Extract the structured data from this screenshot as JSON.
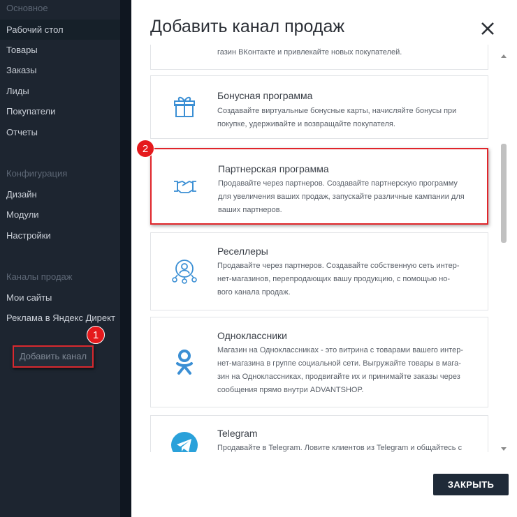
{
  "sidebar": {
    "sections": [
      "Основное",
      "Конфигурация",
      "Каналы продаж"
    ],
    "main_items": [
      "Рабочий стол",
      "Товары",
      "Заказы",
      "Лиды",
      "Покупатели",
      "Отчеты"
    ],
    "config_items": [
      "Дизайн",
      "Модули",
      "Настройки"
    ],
    "channel_items": [
      "Мои сайты",
      "Реклама в Яндекс Директ"
    ],
    "add_channel_label": "Добавить канал",
    "badge_1": "1"
  },
  "modal": {
    "title": "Добавить канал продаж",
    "badge_2": "2",
    "cards": [
      {
        "title": "",
        "desc": [
          "газин ВКонтакте и привлекайте новых покупателей."
        ]
      },
      {
        "title": "Бонусная программа",
        "desc": [
          "Создавайте виртуальные бонусные карты, начисляйте бонусы при",
          "покупке, удерживайте и возвращайте покупателя."
        ]
      },
      {
        "title": "Партнерская программа",
        "desc": [
          "Продавайте через партнеров. Создавайте партнерскую программу",
          "для увеличения ваших продаж, запускайте различные кампании для",
          "ваших партнеров."
        ]
      },
      {
        "title": "Реселлеры",
        "desc": [
          "Продавайте через партнеров. Создавайте собственную сеть интер-",
          "нет-магазинов, перепродающих вашу продукцию, с помощью но-",
          "вого канала продаж."
        ]
      },
      {
        "title": "Одноклассники",
        "desc": [
          "Магазин на Одноклассниках - это витрина с товарами вашего интер-",
          "нет-магазина в группе социальной сети. Выгружайте товары в мага-",
          "зин на Одноклассниках, продвигайте их и принимайте заказы через",
          "сообщения прямо внутри ADVANTSHOP."
        ]
      },
      {
        "title": "Telegram",
        "desc": [
          "Продавайте в Telegram. Ловите клиентов из Telegram и общайтесь с"
        ]
      }
    ],
    "close_button": "ЗАКРЫТЬ"
  },
  "colors": {
    "accent_red": "#e0252a",
    "icon_blue": "#3b8fd4",
    "ok_orange": "#f7931e",
    "telegram_blue": "#2aa1da",
    "dark_button": "#1f2a38"
  }
}
